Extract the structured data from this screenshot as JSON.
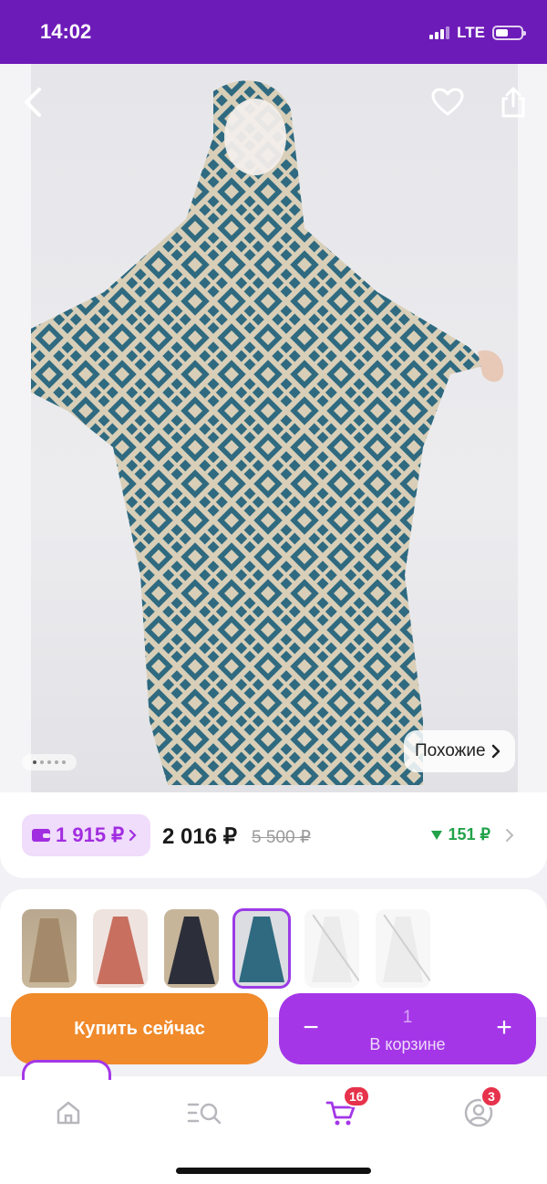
{
  "status": {
    "time": "14:02",
    "network": "LTE"
  },
  "product": {
    "similar_label": "Похожие",
    "photo_count": 5,
    "active_photo": 1
  },
  "price": {
    "wallet_price": "1 915 ₽",
    "price": "2 016 ₽",
    "old_price": "5 500 ₽",
    "drop": "151 ₽"
  },
  "variants": [
    {
      "name": "beige",
      "selected": false,
      "available": true
    },
    {
      "name": "coral-print",
      "selected": false,
      "available": true
    },
    {
      "name": "dark-floral",
      "selected": false,
      "available": true
    },
    {
      "name": "teal-geometric",
      "selected": true,
      "available": true
    },
    {
      "name": "white-1",
      "selected": false,
      "available": false
    },
    {
      "name": "white-2",
      "selected": false,
      "available": false
    }
  ],
  "actions": {
    "buy_label": "Купить сейчас",
    "quantity": "1",
    "cart_label": "В корзине",
    "minus": "−",
    "plus": "+"
  },
  "tabbar": {
    "cart_badge": "16",
    "profile_badge": "3"
  },
  "colors": {
    "brand": "#6d1bb8",
    "accent": "#a436e8",
    "buy": "#f08a2b",
    "badge": "#e6324b",
    "drop": "#22a34a"
  }
}
